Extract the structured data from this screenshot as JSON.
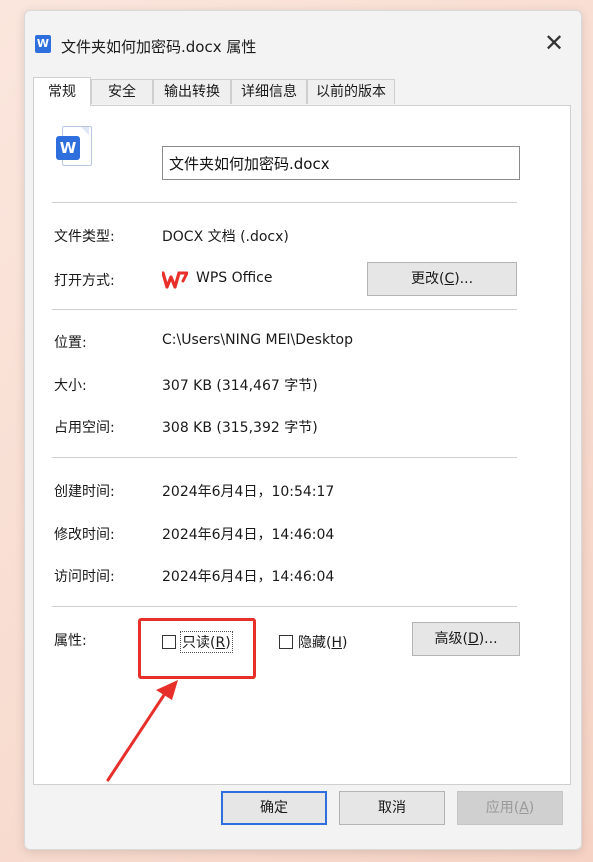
{
  "window": {
    "title": "文件夹如何加密码.docx 属性",
    "close_symbol": "✕"
  },
  "tabs": [
    {
      "label": "常规"
    },
    {
      "label": "安全"
    },
    {
      "label": "输出转换"
    },
    {
      "label": "详细信息"
    },
    {
      "label": "以前的版本"
    }
  ],
  "general": {
    "icon_letter": "W",
    "file_name": "文件夹如何加密码.docx",
    "file_type_label": "文件类型:",
    "file_type_value": "DOCX 文档 (.docx)",
    "open_with_label": "打开方式:",
    "open_with_app": "WPS Office",
    "change_button": {
      "prefix": "更改(",
      "key": "C",
      "suffix": ")..."
    },
    "location_label": "位置:",
    "location_value": "C:\\Users\\NING MEI\\Desktop",
    "size_label": "大小:",
    "size_value": "307 KB (314,467 字节)",
    "size_on_disk_label": "占用空间:",
    "size_on_disk_value": "308 KB (315,392 字节)",
    "created_label": "创建时间:",
    "created_value": "2024年6月4日，10:54:17",
    "modified_label": "修改时间:",
    "modified_value": "2024年6月4日，14:46:04",
    "accessed_label": "访问时间:",
    "accessed_value": "2024年6月4日，14:46:04",
    "attributes_label": "属性:",
    "readonly": {
      "prefix": "只读(",
      "key": "R",
      "suffix": ")",
      "checked": false
    },
    "hidden": {
      "prefix": "隐藏(",
      "key": "H",
      "suffix": ")",
      "checked": false
    },
    "advanced_button": {
      "prefix": "高级(",
      "key": "D",
      "suffix": ")..."
    }
  },
  "footer": {
    "ok": "确定",
    "cancel": "取消",
    "apply": {
      "prefix": "应用(",
      "key": "A",
      "suffix": ")"
    }
  },
  "colors": {
    "accent": "#2f6fdd",
    "highlight": "#e8302a",
    "wps_red": "#e8302a"
  }
}
